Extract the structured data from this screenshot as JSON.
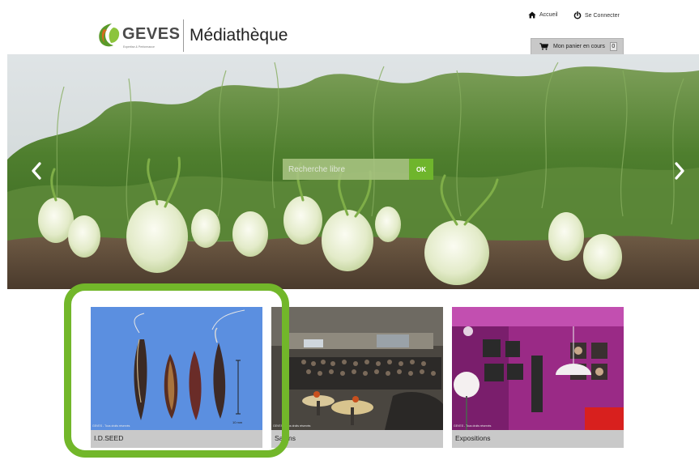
{
  "header": {
    "logo_text": "GEVES",
    "logo_tagline": "Expertise & Performance",
    "site_title": "Médiathèque"
  },
  "top_links": [
    {
      "label": "Accueil",
      "icon": "home-icon"
    },
    {
      "label": "Se Connecter",
      "icon": "power-icon"
    }
  ],
  "cart": {
    "label": "Mon panier en cours",
    "count": "0",
    "icon": "shopping-cart-icon"
  },
  "hero": {
    "search_placeholder": "Recherche libre",
    "search_button": "OK",
    "prev_icon": "chevron-left-icon",
    "next_icon": "chevron-right-icon"
  },
  "cards": [
    {
      "caption": "I.D.SEED",
      "copyright": "GEVES - Tous droits réservés",
      "scale_label": "10 mm"
    },
    {
      "caption": "Salons",
      "copyright": "GEVES - Tous droits réservés"
    },
    {
      "caption": "Expositions",
      "copyright": "GEVES - Tous droits réservés"
    }
  ],
  "colors": {
    "accent_green": "#6fb52c",
    "highlight_green": "#72b72a",
    "caption_gray": "#c9c9c9"
  }
}
